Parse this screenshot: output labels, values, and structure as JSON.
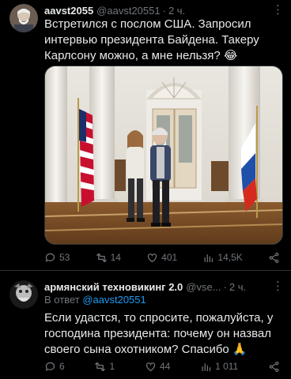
{
  "tweet1": {
    "display_name": "aavst2055",
    "handle": "@aavst20551",
    "dot": "·",
    "time": "2 ч.",
    "more": "⋮",
    "text": "Встретился с послом США. Запросил интервью президента Байдена. Такеру Карлсону можно, а мне нельзя? 😂",
    "replies": "53",
    "reposts": "14",
    "likes": "401",
    "views": "14,5K"
  },
  "tweet2": {
    "display_name": "армянский техновикинг 2.0",
    "handle": "@vse...",
    "dot": "·",
    "time": "2 ч.",
    "more": "⋮",
    "reply_prefix": "В ответ",
    "reply_mention": "@aavst20551",
    "text": "Если удастся, то спросите, пожалуйста, у господина президента: почему он назвал своего сына охотником? Спасибо 🙏",
    "replies": "6",
    "reposts": "1",
    "likes": "44",
    "views": "1 011"
  },
  "colors": {
    "background": "#000000",
    "text": "#e7e9ea",
    "muted": "#71767b",
    "link": "#1d9bf0",
    "divider": "#2f3336"
  },
  "icons": [
    "avatar-photo",
    "reply-icon",
    "repost-icon",
    "like-icon",
    "views-icon",
    "share-icon",
    "more-icon"
  ]
}
